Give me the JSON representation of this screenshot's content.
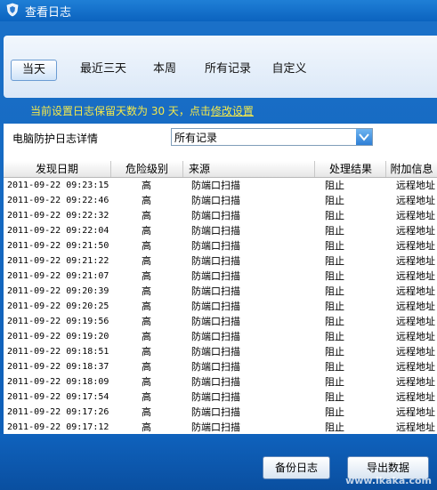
{
  "window": {
    "title": "查看日志"
  },
  "tabs": [
    {
      "label": "当天"
    },
    {
      "label": "最近三天"
    },
    {
      "label": "本周"
    },
    {
      "label": "所有记录"
    },
    {
      "label": "自定义"
    }
  ],
  "notice": {
    "text": "当前设置日志保留天数为 30 天，点击",
    "link": "修改设置"
  },
  "filter": {
    "label": "电脑防护日志详情",
    "selected": "所有记录"
  },
  "table": {
    "columns": [
      "发现日期",
      "危险级别",
      "来源",
      "处理结果",
      "附加信息"
    ],
    "rows": [
      [
        "2011-09-22 09:23:15",
        "高",
        "防端口扫描",
        "阻止",
        "远程地址"
      ],
      [
        "2011-09-22 09:22:46",
        "高",
        "防端口扫描",
        "阻止",
        "远程地址"
      ],
      [
        "2011-09-22 09:22:32",
        "高",
        "防端口扫描",
        "阻止",
        "远程地址"
      ],
      [
        "2011-09-22 09:22:04",
        "高",
        "防端口扫描",
        "阻止",
        "远程地址"
      ],
      [
        "2011-09-22 09:21:50",
        "高",
        "防端口扫描",
        "阻止",
        "远程地址"
      ],
      [
        "2011-09-22 09:21:22",
        "高",
        "防端口扫描",
        "阻止",
        "远程地址"
      ],
      [
        "2011-09-22 09:21:07",
        "高",
        "防端口扫描",
        "阻止",
        "远程地址"
      ],
      [
        "2011-09-22 09:20:39",
        "高",
        "防端口扫描",
        "阻止",
        "远程地址"
      ],
      [
        "2011-09-22 09:20:25",
        "高",
        "防端口扫描",
        "阻止",
        "远程地址"
      ],
      [
        "2011-09-22 09:19:56",
        "高",
        "防端口扫描",
        "阻止",
        "远程地址"
      ],
      [
        "2011-09-22 09:19:20",
        "高",
        "防端口扫描",
        "阻止",
        "远程地址"
      ],
      [
        "2011-09-22 09:18:51",
        "高",
        "防端口扫描",
        "阻止",
        "远程地址"
      ],
      [
        "2011-09-22 09:18:37",
        "高",
        "防端口扫描",
        "阻止",
        "远程地址"
      ],
      [
        "2011-09-22 09:18:09",
        "高",
        "防端口扫描",
        "阻止",
        "远程地址"
      ],
      [
        "2011-09-22 09:17:54",
        "高",
        "防端口扫描",
        "阻止",
        "远程地址"
      ],
      [
        "2011-09-22 09:17:26",
        "高",
        "防端口扫描",
        "阻止",
        "远程地址"
      ],
      [
        "2011-09-22 09:17:12",
        "高",
        "防端口扫描",
        "阻止",
        "远程地址"
      ]
    ]
  },
  "footer": {
    "backup": "备份日志",
    "export": "导出数据",
    "watermark": "www.ikaka.com"
  }
}
